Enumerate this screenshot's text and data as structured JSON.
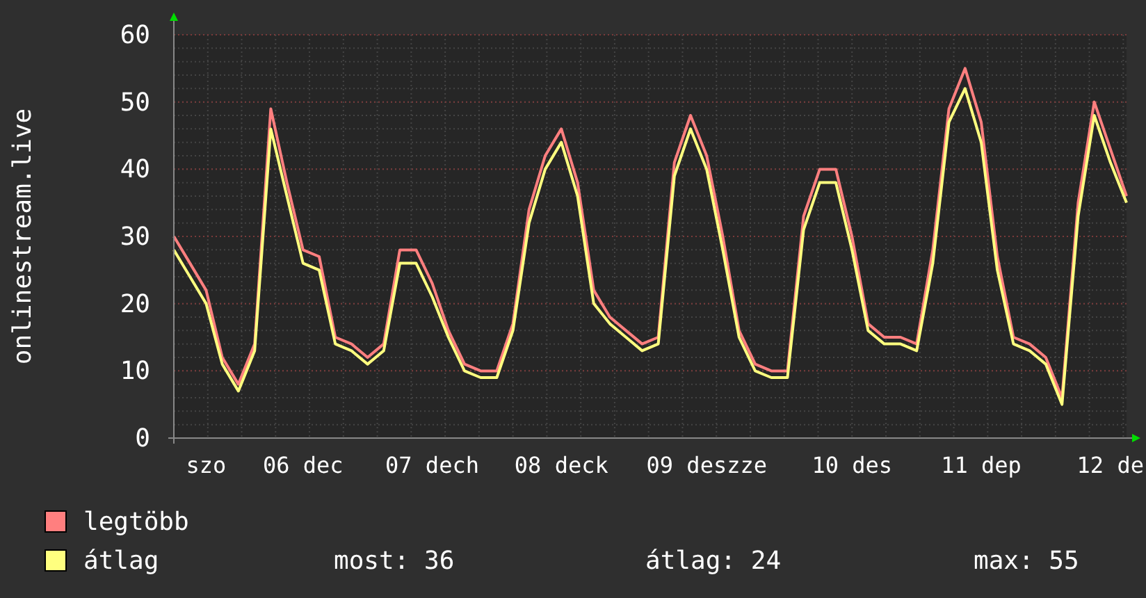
{
  "chart": {
    "chart_data": {
      "type": "line",
      "ylabel": "onlinestream.live",
      "grid": true,
      "ylim": [
        0,
        60
      ],
      "yticks": [
        0,
        10,
        20,
        30,
        40,
        50,
        60
      ],
      "categories": [
        null,
        null,
        "szo",
        null,
        null,
        null,
        null,
        null,
        "06 dec",
        null,
        null,
        null,
        null,
        null,
        null,
        null,
        "07 dech",
        null,
        null,
        null,
        null,
        null,
        null,
        null,
        "08 deck",
        null,
        null,
        null,
        null,
        null,
        null,
        null,
        null,
        "09 deszze",
        null,
        null,
        null,
        null,
        null,
        null,
        null,
        null,
        "10 des",
        null,
        null,
        null,
        null,
        null,
        null,
        null,
        "11 dep",
        null,
        null,
        null,
        null,
        null,
        null,
        null,
        "12 de",
        null
      ],
      "series": [
        {
          "name": "legtöbb",
          "color": "#ff7f7f",
          "values": [
            30,
            26,
            22,
            12,
            8,
            14,
            49,
            38,
            28,
            27,
            15,
            14,
            12,
            14,
            28,
            28,
            23,
            16,
            11,
            10,
            10,
            17,
            34,
            42,
            46,
            38,
            22,
            18,
            16,
            14,
            15,
            41,
            48,
            42,
            30,
            16,
            11,
            10,
            10,
            33,
            40,
            40,
            30,
            17,
            15,
            15,
            14,
            28,
            49,
            55,
            47,
            27,
            15,
            14,
            12,
            6,
            35,
            50,
            43,
            36
          ]
        },
        {
          "name": "átlag",
          "color": "#ffff7f",
          "values": [
            28,
            24,
            20,
            11,
            7,
            13,
            46,
            36,
            26,
            25,
            14,
            13,
            11,
            13,
            26,
            26,
            21,
            15,
            10,
            9,
            9,
            16,
            32,
            40,
            44,
            36,
            20,
            17,
            15,
            13,
            14,
            39,
            46,
            40,
            28,
            15,
            10,
            9,
            9,
            31,
            38,
            38,
            28,
            16,
            14,
            14,
            13,
            26,
            47,
            52,
            44,
            25,
            14,
            13,
            11,
            5,
            33,
            48,
            41,
            35
          ]
        }
      ]
    }
  },
  "stats": [
    "most: 36",
    "átlag: 24",
    "max: 55"
  ]
}
